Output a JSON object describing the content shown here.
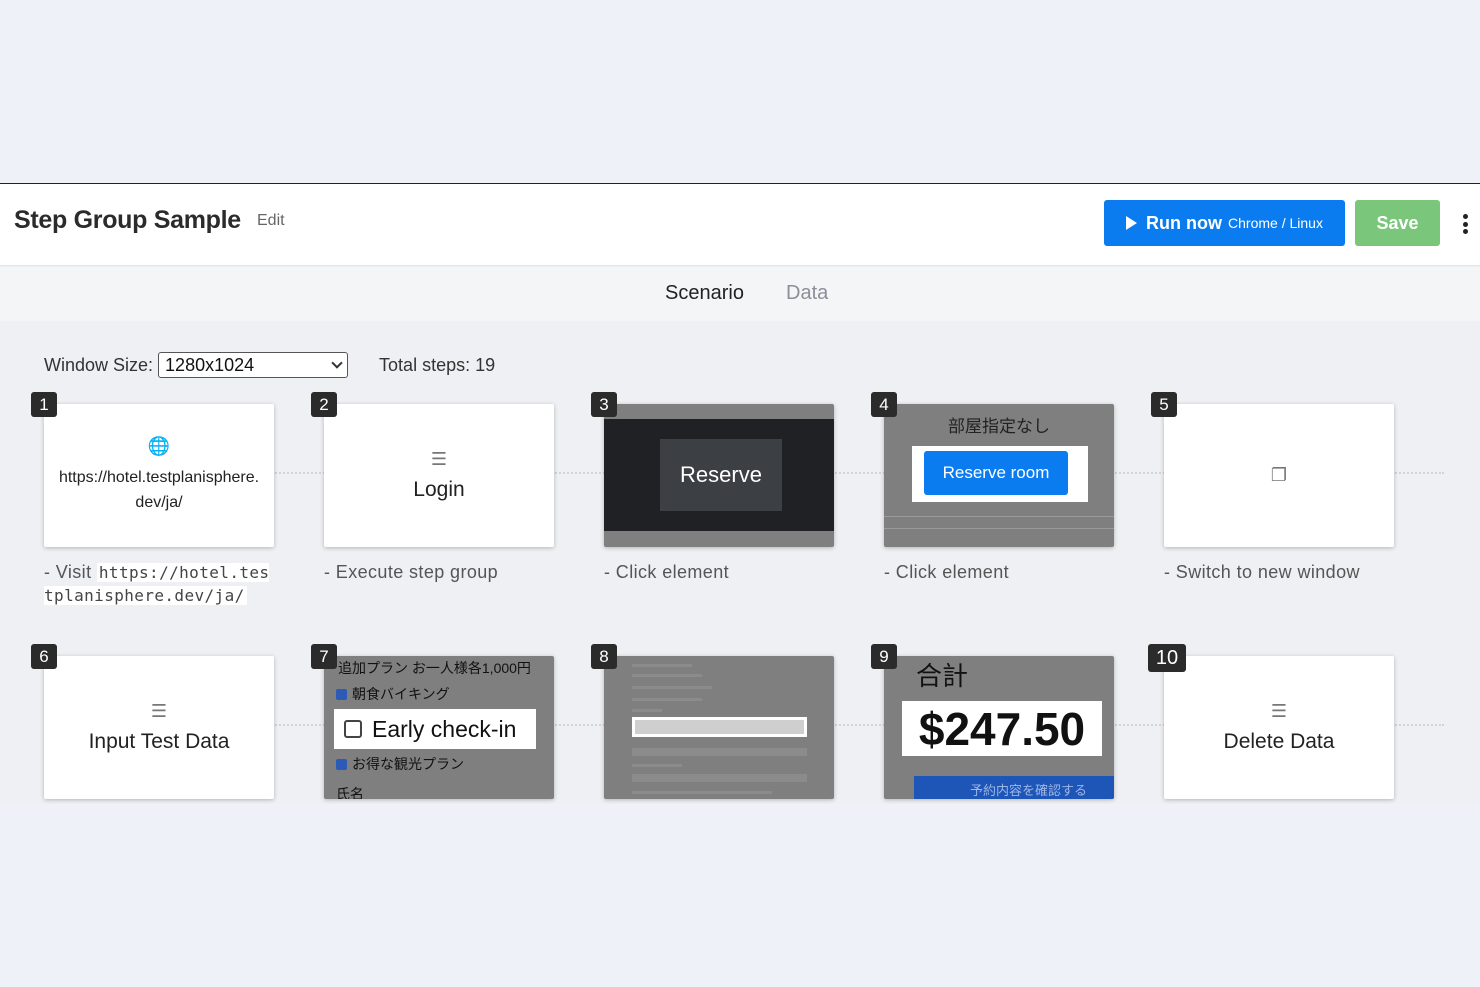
{
  "header": {
    "title": "Step Group Sample",
    "edit_label": "Edit",
    "run_label": "Run now",
    "run_env": "Chrome / Linux",
    "save_label": "Save"
  },
  "tabs": [
    {
      "label": "Scenario",
      "active": true
    },
    {
      "label": "Data",
      "active": false
    }
  ],
  "toolbar": {
    "window_size_label": "Window Size:",
    "window_size_value": "1280x1024",
    "total_steps": "Total steps: 19"
  },
  "steps": [
    {
      "num": "1",
      "icon": "globe-icon",
      "card_text": "https://hotel.testplanisphere.dev/ja/",
      "desc_prefix": "Visit",
      "desc_code": "https://hotel.testplanisphere.dev/ja/"
    },
    {
      "num": "2",
      "icon": "checklist-icon",
      "card_text": "Login",
      "desc": "Execute step group"
    },
    {
      "num": "3",
      "thumb_button": "Reserve",
      "desc": "Click element"
    },
    {
      "num": "4",
      "thumb_top": "部屋指定なし",
      "thumb_button": "Reserve room",
      "desc": "Click element"
    },
    {
      "num": "5",
      "icon": "windows-icon",
      "desc": "Switch to new window"
    },
    {
      "num": "6",
      "icon": "checklist-icon",
      "card_text": "Input Test Data"
    },
    {
      "num": "7",
      "thumb_rows": [
        "追加プラン お一人様各1,000円",
        "朝食バイキング",
        "Early check-in",
        "お得な観光プラン",
        "氏名"
      ]
    },
    {
      "num": "8"
    },
    {
      "num": "9",
      "thumb_label": "合計",
      "thumb_amount": "$247.50",
      "thumb_bar": "予約内容を確認する"
    },
    {
      "num": "10",
      "icon": "checklist-icon",
      "card_text": "Delete Data"
    }
  ]
}
